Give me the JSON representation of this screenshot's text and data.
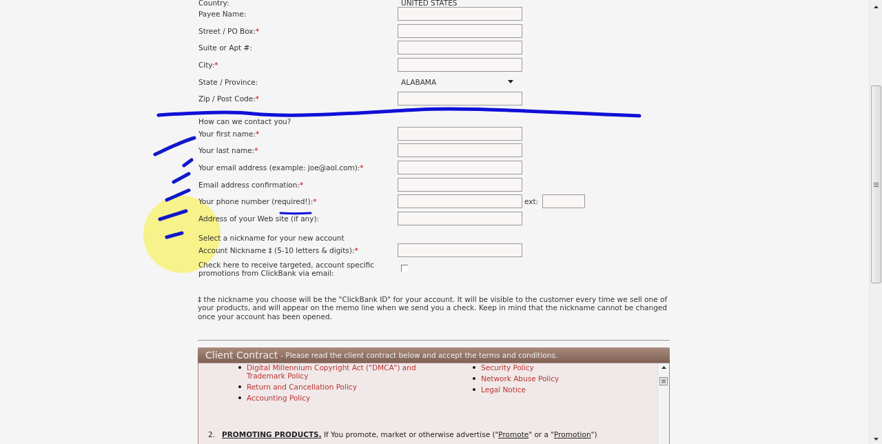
{
  "country": {
    "label": "Country:",
    "value": "UNITED STATES"
  },
  "address_fields": [
    {
      "label": "Payee Name:",
      "kind": "input"
    },
    {
      "label": "Street / PO Box:",
      "required_mark": "*",
      "kind": "input"
    },
    {
      "label": "Suite or Apt #:",
      "kind": "input"
    },
    {
      "label": "City:",
      "required_mark": "*",
      "kind": "input"
    },
    {
      "label": "State / Province:",
      "kind": "select",
      "value": "ALABAMA"
    },
    {
      "label": "Zip / Post Code:",
      "required_mark": "*",
      "kind": "input"
    }
  ],
  "contact_heading": "How can we contact you?",
  "contact_fields": [
    {
      "label": "Your first name:",
      "required_mark": "*",
      "kind": "input"
    },
    {
      "label": "Your last name:",
      "required_mark": "*",
      "kind": "input"
    },
    {
      "label": "Your email address (example: joe@aol.com):",
      "required_mark": "*",
      "kind": "input"
    },
    {
      "label": "Email address confirmation:",
      "required_mark": "*",
      "kind": "input"
    },
    {
      "label": "Your phone number (required!):",
      "required_mark": "*",
      "kind": "phone",
      "ext_label": "ext:"
    },
    {
      "label": "Address of your Web site (if any):",
      "kind": "input"
    }
  ],
  "nickname_heading": "Select a nickname for your new account",
  "nickname_field": {
    "label": "Account Nickname ‡ (5-10 letters & digits):",
    "required_mark": "*"
  },
  "promotions": {
    "label": "Check here to receive targeted, account specific promotions from ClickBank via email:",
    "checked": false
  },
  "footnote": "‡ the nickname you choose will be the \"ClickBank ID\" for your account. It will be visible to the customer every time we sell one of your products, and will appear on the memo line when we send you a check. Keep in mind that the nickname cannot be changed once your account has been opened.",
  "contract": {
    "title": "Client Contract",
    "subtitle": "- Please read the client contract below and accept the terms and conditions.",
    "links_left": [
      "Digital Millennium Copyright Act (\"DMCA\") and Trademark Policy",
      "Return and Cancellation Policy",
      "Accounting Policy"
    ],
    "links_right": [
      "Security Policy",
      "Network Abuse Policy",
      "Legal Notice"
    ],
    "clause": {
      "number": "2.",
      "heading": "PROMOTING PRODUCTS.",
      "parts": [
        {
          "text": " If You promote, market or otherwise advertise (\"",
          "underline": false
        },
        {
          "text": "Promote",
          "underline": true
        },
        {
          "text": "\" or a \"",
          "underline": false
        },
        {
          "text": "Promotion",
          "underline": true
        },
        {
          "text": "\")",
          "underline": false
        }
      ]
    }
  }
}
